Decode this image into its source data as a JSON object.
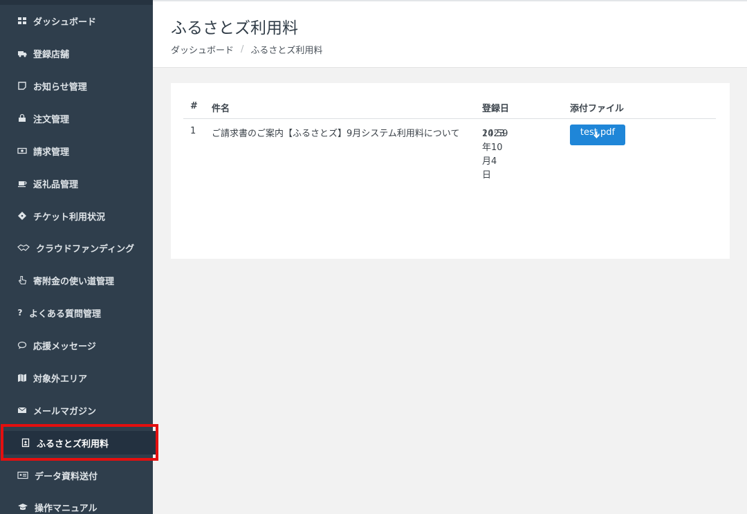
{
  "sidebar": {
    "items": [
      {
        "label": "ダッシュボード",
        "icon": "dashboard-icon"
      },
      {
        "label": "登録店舗",
        "icon": "truck-icon"
      },
      {
        "label": "お知らせ管理",
        "icon": "note-icon"
      },
      {
        "label": "注文管理",
        "icon": "shopping-bag-icon"
      },
      {
        "label": "請求管理",
        "icon": "money-icon"
      },
      {
        "label": "返礼品管理",
        "icon": "coffee-icon"
      },
      {
        "label": "チケット利用状況",
        "icon": "ticket-icon"
      },
      {
        "label": "クラウドファンディング",
        "icon": "handshake-icon"
      },
      {
        "label": "寄附金の使い道管理",
        "icon": "hand-pointer-icon"
      },
      {
        "label": "よくある質問管理",
        "icon": "question-icon"
      },
      {
        "label": "応援メッセージ",
        "icon": "comment-icon"
      },
      {
        "label": "対象外エリア",
        "icon": "map-icon"
      },
      {
        "label": "メールマガジン",
        "icon": "envelope-icon"
      },
      {
        "label": "ふるさとズ利用料",
        "icon": "address-book-icon",
        "active": true
      },
      {
        "label": "データ資料送付",
        "icon": "id-card-icon"
      },
      {
        "label": "操作マニュアル",
        "icon": "graduation-cap-icon"
      }
    ]
  },
  "header": {
    "title": "ふるさとズ利用料",
    "breadcrumb": {
      "home": "ダッシュボード",
      "separator": "/",
      "current": "ふるさとズ利用料"
    }
  },
  "table": {
    "headers": {
      "num": "#",
      "subject": "件名",
      "date": "登録日",
      "attachment": "添付ファイル"
    },
    "rows": [
      {
        "num": "1",
        "subject": "ご請求書のご案内【ふるさとズ】9月システム利用料について",
        "date": "2023年10月4日",
        "time": "14:59",
        "file": "test.pdf"
      }
    ]
  },
  "colors": {
    "sidebar_bg": "#2f3e4c",
    "accent": "#1f86d8",
    "highlight": "#e40f0f"
  }
}
